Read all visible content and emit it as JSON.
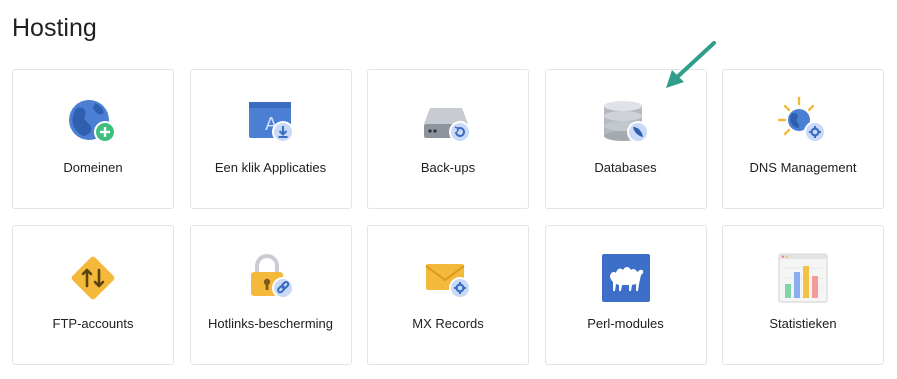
{
  "page": {
    "title": "Hosting"
  },
  "tiles": [
    {
      "label": "Domeinen",
      "icon": "globe-plus-icon"
    },
    {
      "label": "Een klik Applicaties",
      "icon": "app-folder-icon"
    },
    {
      "label": "Back-ups",
      "icon": "backup-drive-icon"
    },
    {
      "label": "Databases",
      "icon": "database-icon"
    },
    {
      "label": "DNS Management",
      "icon": "dns-globe-icon"
    },
    {
      "label": "FTP-accounts",
      "icon": "ftp-transfer-icon"
    },
    {
      "label": "Hotlinks-bescherming",
      "icon": "lock-link-icon"
    },
    {
      "label": "MX Records",
      "icon": "mail-gear-icon"
    },
    {
      "label": "Perl-modules",
      "icon": "perl-camel-icon"
    },
    {
      "label": "Statistieken",
      "icon": "statistics-chart-icon"
    }
  ],
  "colors": {
    "accent_blue": "#4a7fd4",
    "badge_blue": "#c9daf8",
    "annotation_arrow": "#2f9e8a",
    "tile_border": "#e4e4e4",
    "ftp_yellow": "#f4b93a"
  }
}
